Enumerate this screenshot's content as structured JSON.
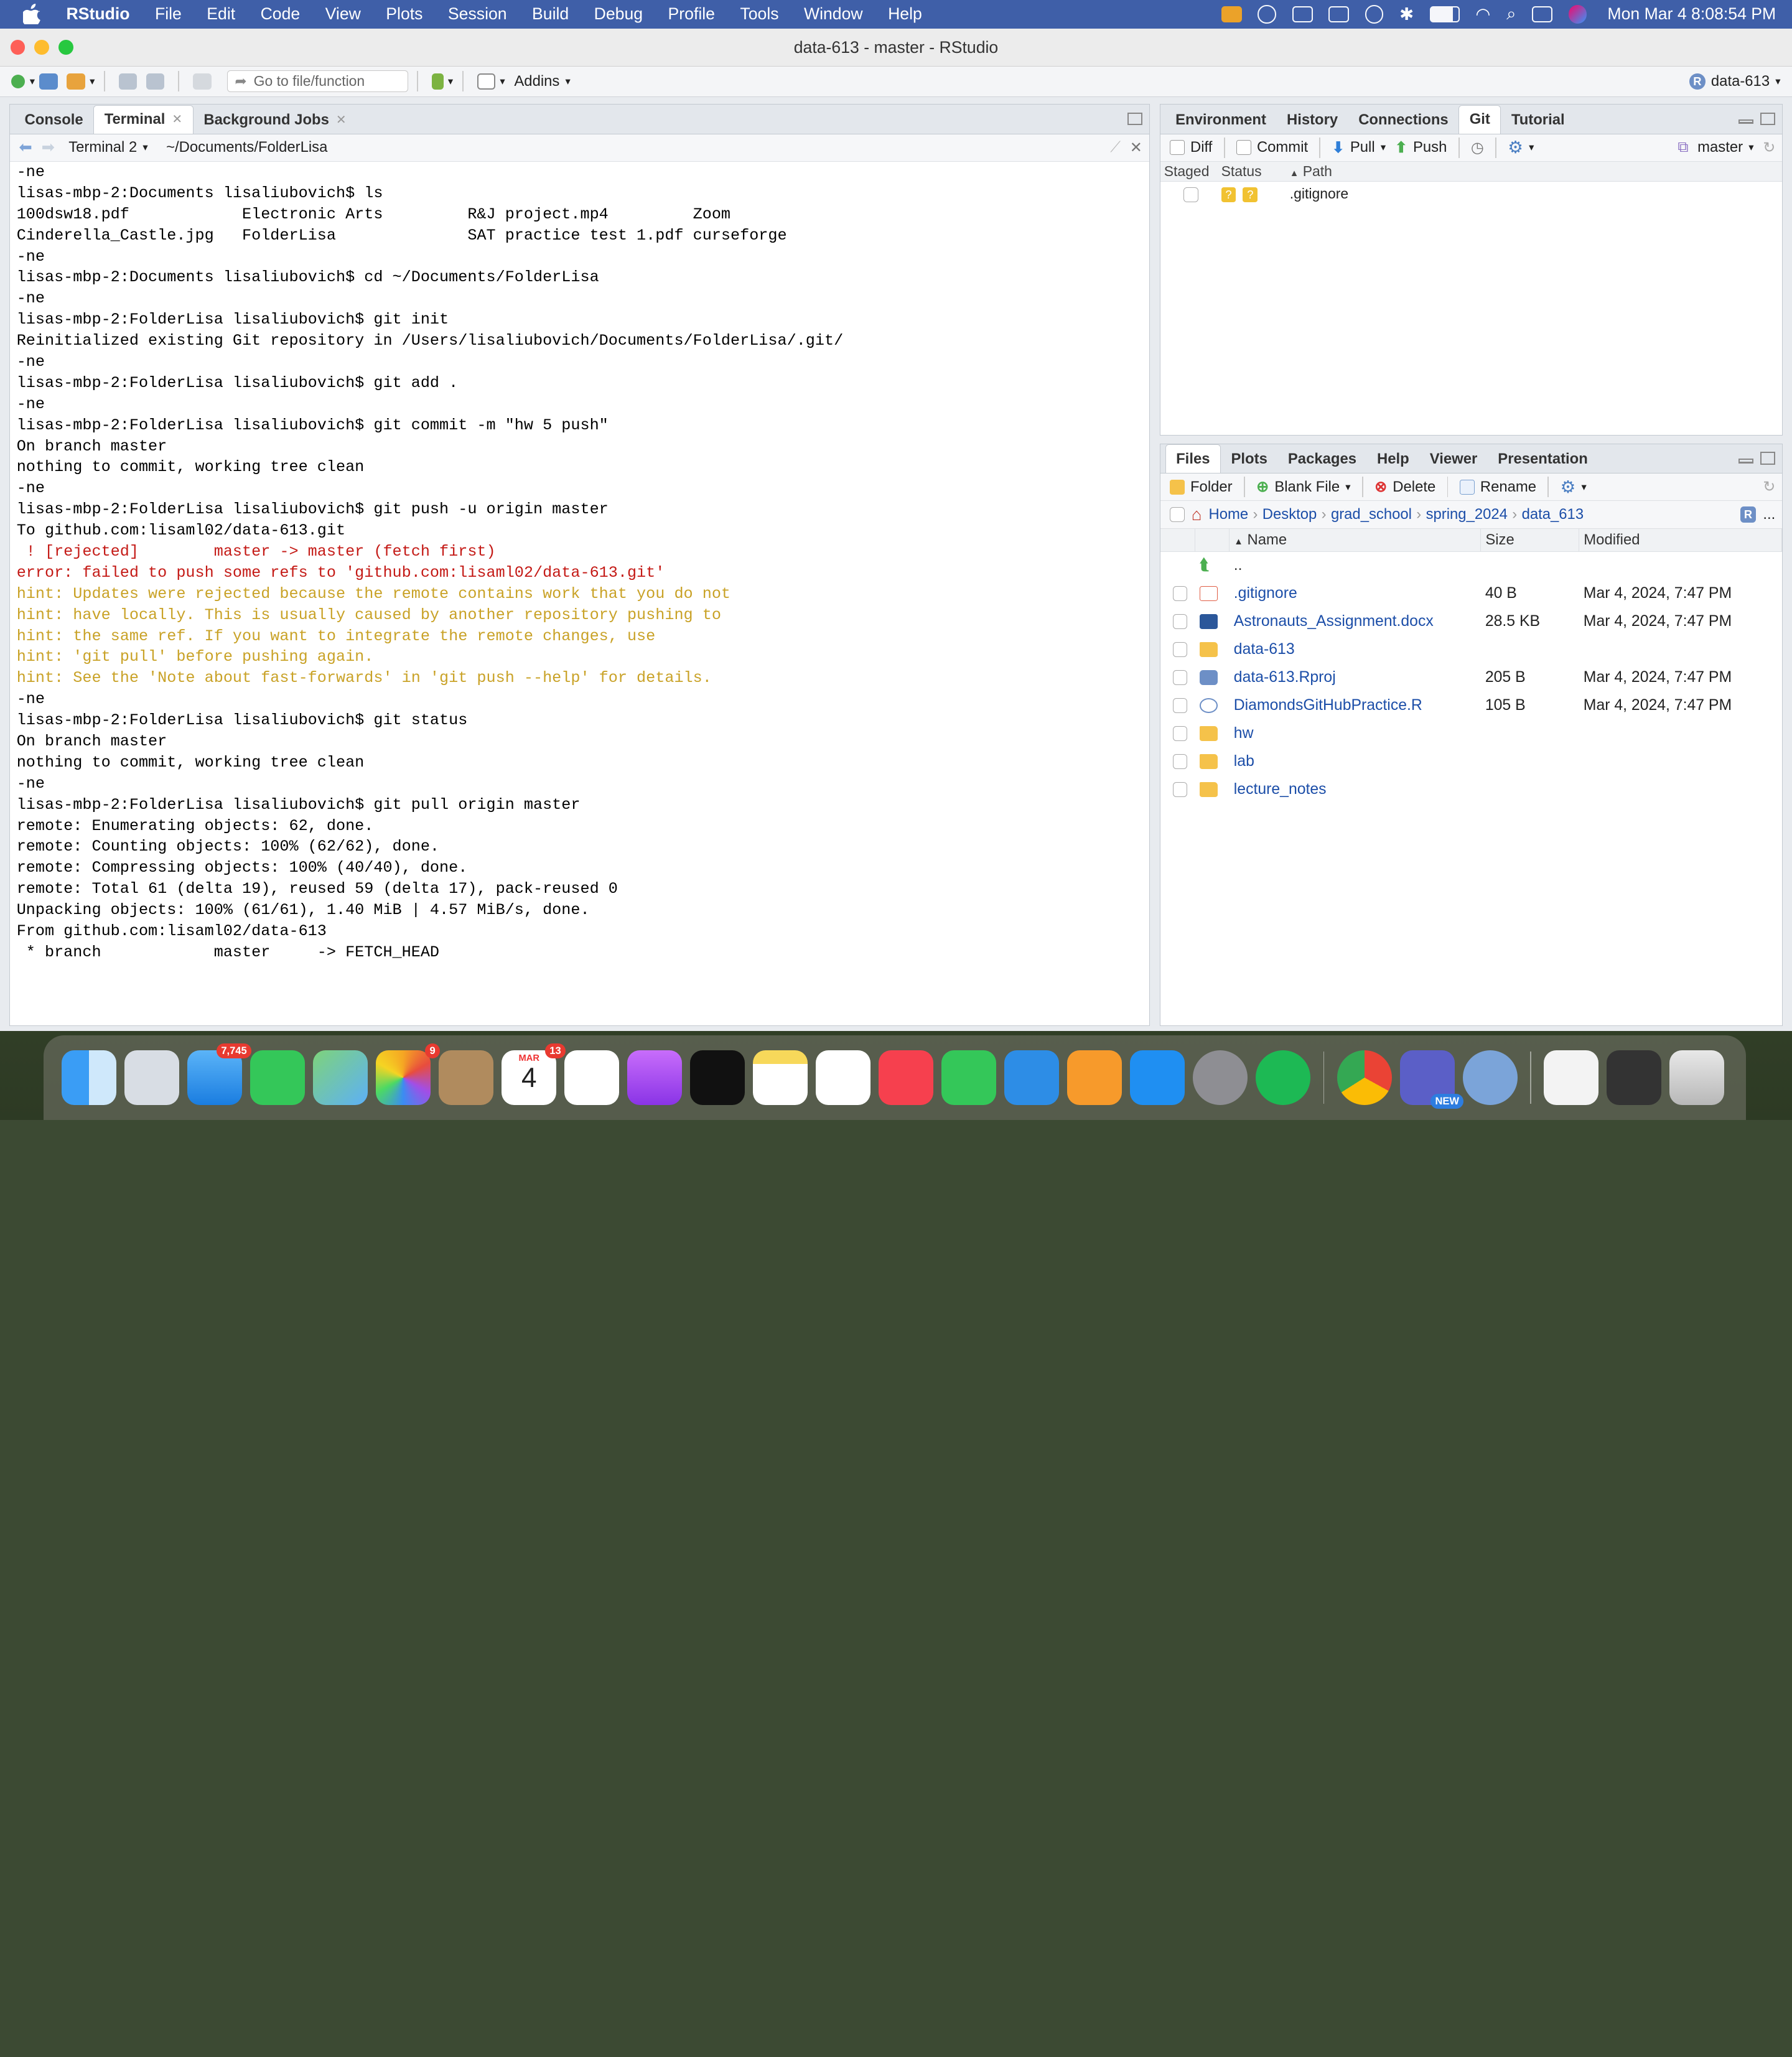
{
  "menubar": {
    "items": [
      "RStudio",
      "File",
      "Edit",
      "Code",
      "View",
      "Plots",
      "Session",
      "Build",
      "Debug",
      "Profile",
      "Tools",
      "Window",
      "Help"
    ],
    "clock": "Mon Mar 4  8:08:54 PM"
  },
  "window": {
    "title": "data-613 - master - RStudio"
  },
  "toolbar": {
    "goto_placeholder": "Go to file/function",
    "addins": "Addins",
    "project": "data-613"
  },
  "left": {
    "tabs": [
      "Console",
      "Terminal",
      "Background Jobs"
    ],
    "terminal_name": "Terminal 2",
    "cwd": "~/Documents/FolderLisa",
    "lines": [
      {
        "t": "-ne",
        "k": "n"
      },
      {
        "t": "lisas-mbp-2:Documents lisaliubovich$ ls",
        "k": "n"
      },
      {
        "t": "100dsw18.pdf            Electronic Arts         R&J project.mp4         Zoom",
        "k": "n"
      },
      {
        "t": "Cinderella_Castle.jpg   FolderLisa              SAT practice test 1.pdf curseforge",
        "k": "n"
      },
      {
        "t": "-ne",
        "k": "n"
      },
      {
        "t": "lisas-mbp-2:Documents lisaliubovich$ cd ~/Documents/FolderLisa",
        "k": "n"
      },
      {
        "t": "-ne",
        "k": "n"
      },
      {
        "t": "lisas-mbp-2:FolderLisa lisaliubovich$ git init",
        "k": "n"
      },
      {
        "t": "Reinitialized existing Git repository in /Users/lisaliubovich/Documents/FolderLisa/.git/",
        "k": "n"
      },
      {
        "t": "-ne",
        "k": "n"
      },
      {
        "t": "lisas-mbp-2:FolderLisa lisaliubovich$ git add .",
        "k": "n"
      },
      {
        "t": "-ne",
        "k": "n"
      },
      {
        "t": "lisas-mbp-2:FolderLisa lisaliubovich$ git commit -m \"hw 5 push\"",
        "k": "n"
      },
      {
        "t": "On branch master",
        "k": "n"
      },
      {
        "t": "nothing to commit, working tree clean",
        "k": "n"
      },
      {
        "t": "-ne",
        "k": "n"
      },
      {
        "t": "lisas-mbp-2:FolderLisa lisaliubovich$ git push -u origin master",
        "k": "n"
      },
      {
        "t": "To github.com:lisaml02/data-613.git",
        "k": "n"
      },
      {
        "t": " ! [rejected]        master -> master (fetch first)",
        "k": "e"
      },
      {
        "t": "error: failed to push some refs to 'github.com:lisaml02/data-613.git'",
        "k": "e"
      },
      {
        "t": "hint: Updates were rejected because the remote contains work that you do not",
        "k": "h"
      },
      {
        "t": "hint: have locally. This is usually caused by another repository pushing to",
        "k": "h"
      },
      {
        "t": "hint: the same ref. If you want to integrate the remote changes, use",
        "k": "h"
      },
      {
        "t": "hint: 'git pull' before pushing again.",
        "k": "h"
      },
      {
        "t": "hint: See the 'Note about fast-forwards' in 'git push --help' for details.",
        "k": "h"
      },
      {
        "t": "-ne",
        "k": "n"
      },
      {
        "t": "lisas-mbp-2:FolderLisa lisaliubovich$ git status",
        "k": "n"
      },
      {
        "t": "On branch master",
        "k": "n"
      },
      {
        "t": "nothing to commit, working tree clean",
        "k": "n"
      },
      {
        "t": "-ne",
        "k": "n"
      },
      {
        "t": "lisas-mbp-2:FolderLisa lisaliubovich$ git pull origin master",
        "k": "n"
      },
      {
        "t": "remote: Enumerating objects: 62, done.",
        "k": "n"
      },
      {
        "t": "remote: Counting objects: 100% (62/62), done.",
        "k": "n"
      },
      {
        "t": "remote: Compressing objects: 100% (40/40), done.",
        "k": "n"
      },
      {
        "t": "remote: Total 61 (delta 19), reused 59 (delta 17), pack-reused 0",
        "k": "n"
      },
      {
        "t": "Unpacking objects: 100% (61/61), 1.40 MiB | 4.57 MiB/s, done.",
        "k": "n"
      },
      {
        "t": "From github.com:lisaml02/data-613",
        "k": "n"
      },
      {
        "t": " * branch            master     -> FETCH_HEAD",
        "k": "n"
      }
    ]
  },
  "git": {
    "tabs": [
      "Environment",
      "History",
      "Connections",
      "Git",
      "Tutorial"
    ],
    "buttons": {
      "diff": "Diff",
      "commit": "Commit",
      "pull": "Pull",
      "push": "Push",
      "branch": "master"
    },
    "headers": [
      "Staged",
      "Status",
      "Path"
    ],
    "rows": [
      {
        "path": ".gitignore",
        "status": "?"
      }
    ]
  },
  "files": {
    "tabs": [
      "Files",
      "Plots",
      "Packages",
      "Help",
      "Viewer",
      "Presentation"
    ],
    "buttons": {
      "folder": "Folder",
      "blank": "Blank File",
      "delete": "Delete",
      "rename": "Rename"
    },
    "breadcrumb": [
      "Home",
      "Desktop",
      "grad_school",
      "spring_2024",
      "data_613"
    ],
    "more": "...",
    "headers": [
      "Name",
      "Size",
      "Modified"
    ],
    "up": "..",
    "rows": [
      {
        "name": ".gitignore",
        "size": "40 B",
        "mod": "Mar 4, 2024, 7:47 PM",
        "kind": "git"
      },
      {
        "name": "Astronauts_Assignment.docx",
        "size": "28.5 KB",
        "mod": "Mar 4, 2024, 7:47 PM",
        "kind": "word"
      },
      {
        "name": "data-613",
        "size": "",
        "mod": "",
        "kind": "folder"
      },
      {
        "name": "data-613.Rproj",
        "size": "205 B",
        "mod": "Mar 4, 2024, 7:47 PM",
        "kind": "rproj"
      },
      {
        "name": "DiamondsGitHubPractice.R",
        "size": "105 B",
        "mod": "Mar 4, 2024, 7:47 PM",
        "kind": "r"
      },
      {
        "name": "hw",
        "size": "",
        "mod": "",
        "kind": "folder"
      },
      {
        "name": "lab",
        "size": "",
        "mod": "",
        "kind": "folder"
      },
      {
        "name": "lecture_notes",
        "size": "",
        "mod": "",
        "kind": "folder"
      }
    ]
  },
  "dock": {
    "mail_badge": "7,745",
    "photos_badge": "9",
    "calendar_month": "MAR",
    "calendar_day": "4",
    "calendar_badge": "13",
    "teams_label": "NEW"
  },
  "colors": {
    "menubar": "#3f5fa8",
    "error": "#c41a16",
    "hint": "#c9a227",
    "link": "#1c4ea8"
  }
}
